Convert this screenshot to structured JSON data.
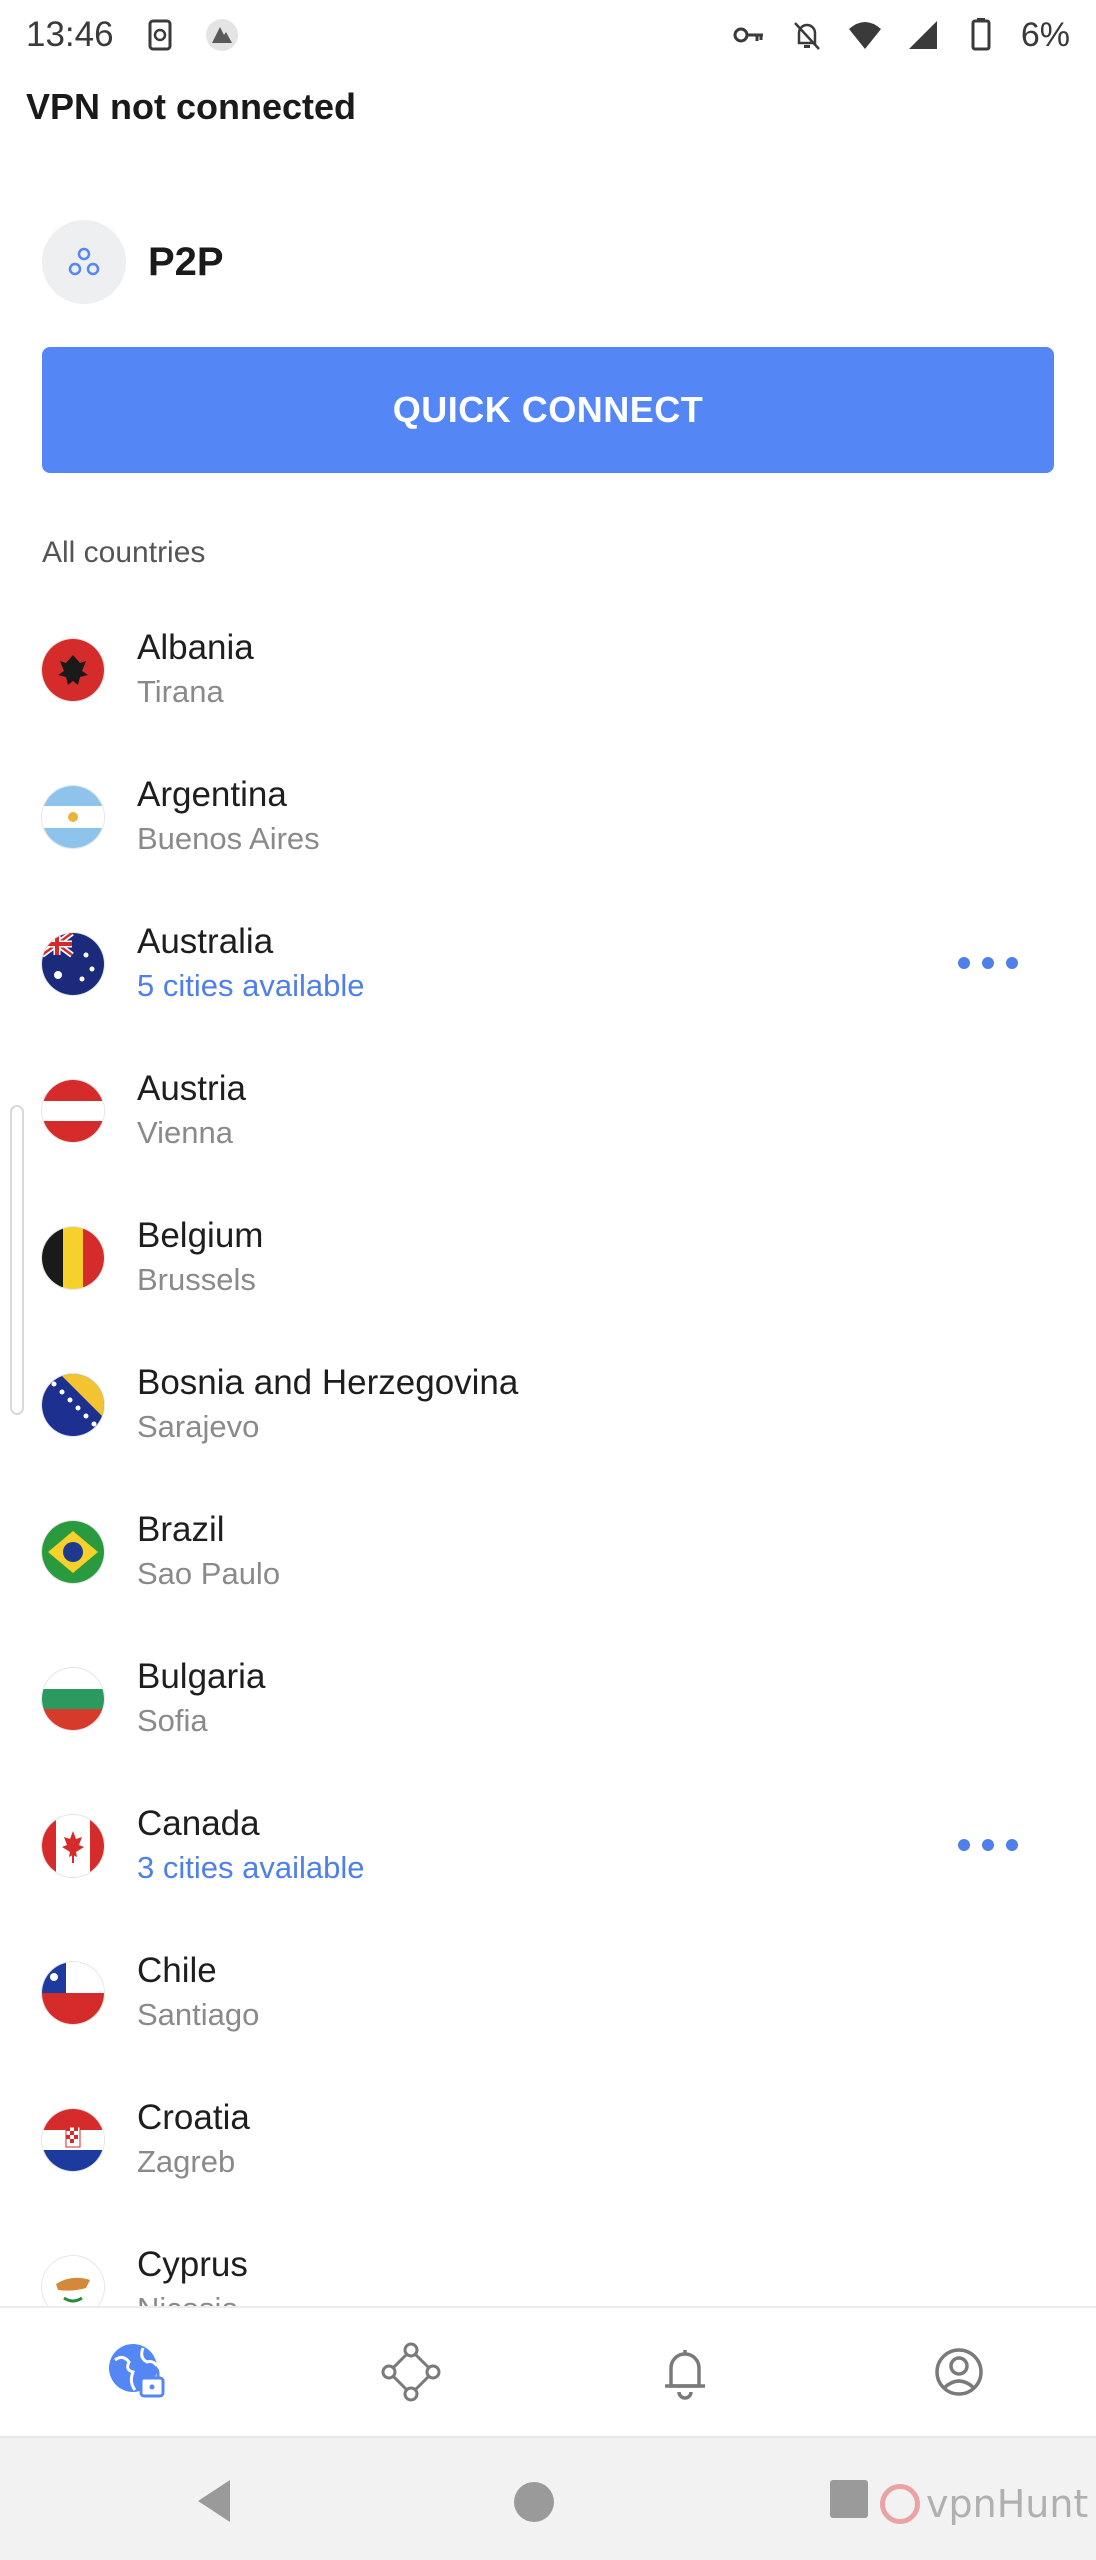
{
  "status_bar": {
    "time": "13:46",
    "battery": "6%",
    "left_icons": [
      "sim-toolkit-icon",
      "nordvpn-icon"
    ],
    "right_icons": [
      "vpn-key-icon",
      "notifications-off-icon",
      "wifi-icon",
      "signal-icon",
      "battery-icon"
    ]
  },
  "vpn_status": "VPN not connected",
  "profile": {
    "name": "P2P",
    "icon": "p2p-icon"
  },
  "quick_connect_label": "QUICK CONNECT",
  "section_label": "All countries",
  "colors": {
    "accent": "#5487f5",
    "link": "#4f7fe8",
    "muted": "#8a8a8a"
  },
  "countries": [
    {
      "name": "Albania",
      "sub": "Tirana",
      "flag": "al",
      "multi": false
    },
    {
      "name": "Argentina",
      "sub": "Buenos Aires",
      "flag": "ar",
      "multi": false
    },
    {
      "name": "Australia",
      "sub": "5 cities available",
      "flag": "au",
      "multi": true
    },
    {
      "name": "Austria",
      "sub": "Vienna",
      "flag": "at",
      "multi": false
    },
    {
      "name": "Belgium",
      "sub": "Brussels",
      "flag": "be",
      "multi": false
    },
    {
      "name": "Bosnia and Herzegovina",
      "sub": "Sarajevo",
      "flag": "ba",
      "multi": false
    },
    {
      "name": "Brazil",
      "sub": "Sao Paulo",
      "flag": "br",
      "multi": false
    },
    {
      "name": "Bulgaria",
      "sub": "Sofia",
      "flag": "bg",
      "multi": false
    },
    {
      "name": "Canada",
      "sub": "3 cities available",
      "flag": "ca",
      "multi": true
    },
    {
      "name": "Chile",
      "sub": "Santiago",
      "flag": "cl",
      "multi": false
    },
    {
      "name": "Croatia",
      "sub": "Zagreb",
      "flag": "hr",
      "multi": false
    },
    {
      "name": "Cyprus",
      "sub": "Nicosia",
      "flag": "cy",
      "multi": false
    }
  ],
  "bottom_nav": [
    {
      "name": "globe-lock-icon",
      "active": true
    },
    {
      "name": "meshnet-icon",
      "active": false
    },
    {
      "name": "bell-icon",
      "active": false
    },
    {
      "name": "profile-icon",
      "active": false
    }
  ],
  "watermark": "vpnHunt"
}
